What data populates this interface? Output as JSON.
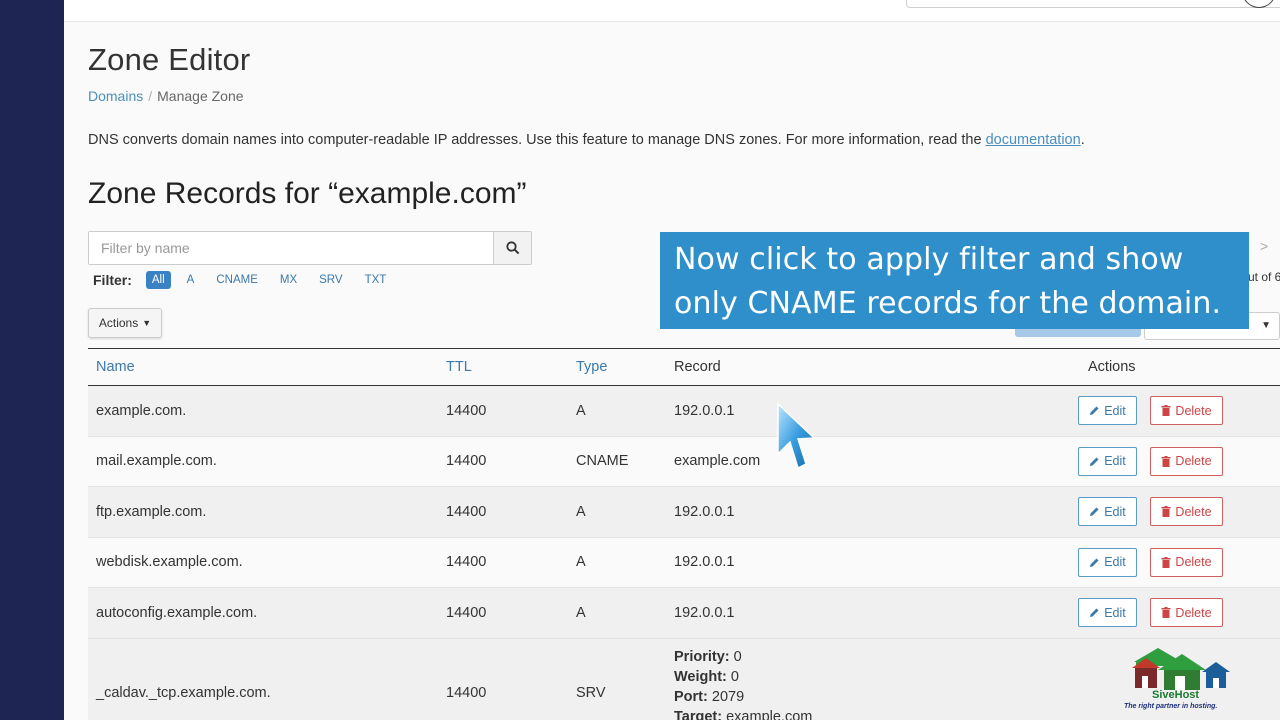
{
  "page": {
    "title": "Zone Editor",
    "breadcrumb": {
      "link": "Domains",
      "separator": "/",
      "current": "Manage Zone"
    },
    "description_prefix": "DNS converts domain names into computer-readable IP addresses. Use this feature to manage DNS zones. For more information, read the ",
    "description_link": "documentation",
    "description_suffix": "."
  },
  "zone": {
    "title": "Zone Records for “example.com”",
    "filter_placeholder": "Filter by name",
    "filter_label": "Filter:",
    "filter_options": [
      "All",
      "A",
      "CNAME",
      "MX",
      "SRV",
      "TXT"
    ],
    "active_filter": "All",
    "actions_label": "Actions",
    "pager_text": "ut of 6",
    "pager_arrow": ">"
  },
  "table": {
    "headers": {
      "name": "Name",
      "ttl": "TTL",
      "type": "Type",
      "record": "Record",
      "actions": "Actions"
    },
    "edit_label": "Edit",
    "delete_label": "Delete",
    "rows": [
      {
        "name": "example.com.",
        "ttl": "14400",
        "type": "A",
        "record": "192.0.0.1"
      },
      {
        "name": "mail.example.com.",
        "ttl": "14400",
        "type": "CNAME",
        "record": "example.com"
      },
      {
        "name": "ftp.example.com.",
        "ttl": "14400",
        "type": "A",
        "record": "192.0.0.1"
      },
      {
        "name": "webdisk.example.com.",
        "ttl": "14400",
        "type": "A",
        "record": "192.0.0.1"
      },
      {
        "name": "autoconfig.example.com.",
        "ttl": "14400",
        "type": "A",
        "record": "192.0.0.1"
      }
    ],
    "srv_row": {
      "name": "_caldav._tcp.example.com.",
      "ttl": "14400",
      "type": "SRV",
      "priority_label": "Priority:",
      "priority": "0",
      "weight_label": "Weight:",
      "weight": "0",
      "port_label": "Port:",
      "port": "2079",
      "target_label": "Target:",
      "target": "example.com"
    }
  },
  "callout": {
    "text": "Now click to apply filter and show only CNAME records for the domain."
  },
  "logo": {
    "name": "SiveHost",
    "tagline": "The right partner in hosting."
  },
  "colors": {
    "sidebar": "#1f2552",
    "accent": "#3b82c4",
    "callout": "#2f8fcb",
    "delete": "#c44444"
  }
}
